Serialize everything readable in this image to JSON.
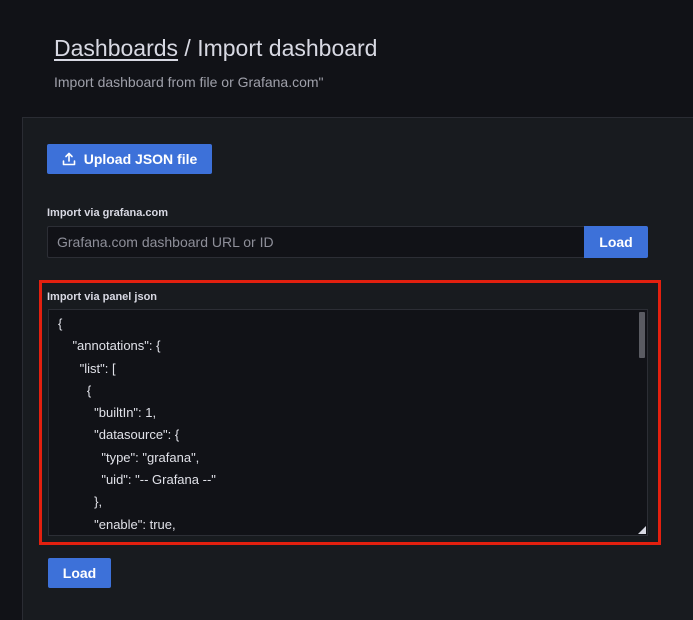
{
  "header": {
    "breadcrumb_link": "Dashboards",
    "separator": " / ",
    "title": "Import dashboard",
    "subtitle": "Import dashboard from file or Grafana.com\""
  },
  "upload": {
    "label": "Upload JSON file",
    "icon": "upload-icon"
  },
  "grafana_com": {
    "label": "Import via grafana.com",
    "placeholder": "Grafana.com dashboard URL or ID",
    "value": "",
    "button_label": "Load"
  },
  "panel_json": {
    "label": "Import via panel json",
    "content": "{\n    \"annotations\": {\n      \"list\": [\n        {\n          \"builtIn\": 1,\n          \"datasource\": {\n            \"type\": \"grafana\",\n            \"uid\": \"-- Grafana --\"\n          },\n          \"enable\": true,"
  },
  "bottom_button_label": "Load",
  "colors": {
    "background": "#111217",
    "panel": "#181b1f",
    "primary_button": "#3d71d9",
    "highlight_border": "#e3200f"
  }
}
